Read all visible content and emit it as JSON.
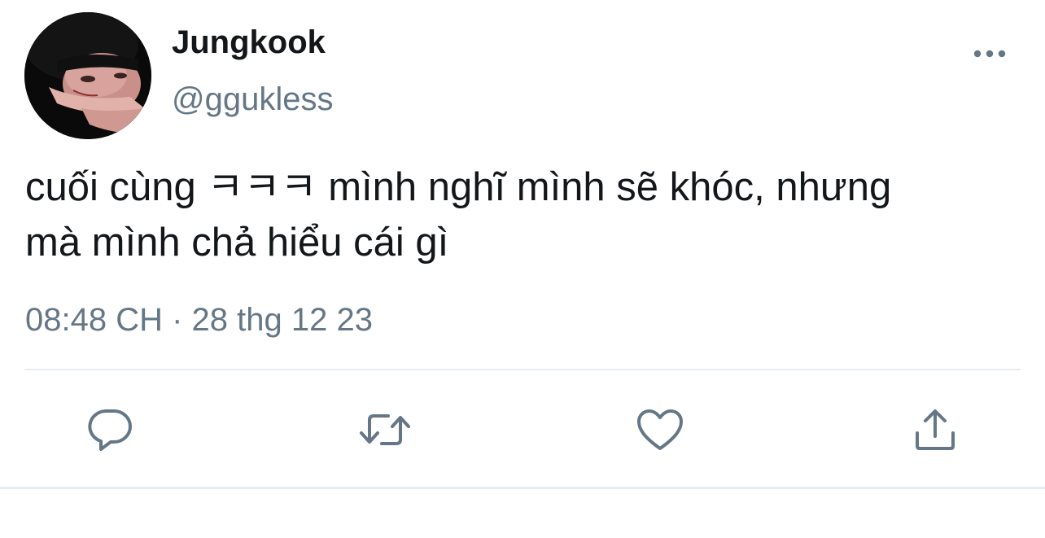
{
  "tweet": {
    "author": {
      "display_name": "Jungkook",
      "handle": "@ggukless",
      "avatar": "profile-photo"
    },
    "text_line_1": "cuối cùng ㅋㅋㅋ mình nghĩ mình sẽ khóc, nhưng",
    "text_line_2": "mà mình chả hiểu cái gì",
    "timestamp": "08:48 CH · 28 thg 12 23",
    "more_icon": "more-horizontal-icon"
  },
  "actions": [
    {
      "name": "reply",
      "icon": "reply-icon"
    },
    {
      "name": "retweet",
      "icon": "retweet-icon"
    },
    {
      "name": "like",
      "icon": "heart-icon"
    },
    {
      "name": "share",
      "icon": "share-icon"
    }
  ],
  "colors": {
    "text_primary": "#14171a",
    "text_secondary": "#657786",
    "divider": "#e6ecf0",
    "icon": "#657786"
  }
}
